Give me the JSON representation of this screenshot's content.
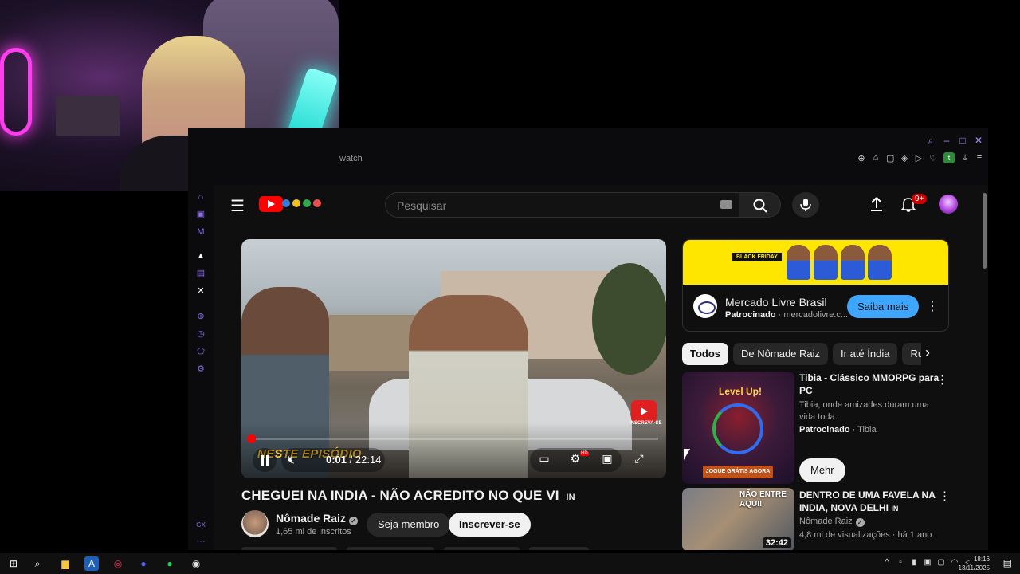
{
  "browser": {
    "url_fragment": "watch"
  },
  "youtube": {
    "search_placeholder": "Pesquisar",
    "notifications_badge": "9+",
    "video": {
      "title": "CHEGUEI NA INDIA - NÃO ACREDITO NO QUE VI",
      "title_suffix": "IN",
      "overlay_text": "NESTE EPISÓDIO",
      "subscribe_watermark": "INSCREVA-SE",
      "current_time": "0:01",
      "duration": "22:14",
      "time_separator": " / ",
      "quality_badge": "HD",
      "progress_fraction": 0.001
    },
    "channel": {
      "name": "Nômade Raiz",
      "subscribers": "1,65 mi de inscritos",
      "member_button": "Seja membro",
      "subscribe_button": "Inscrever-se"
    },
    "ad": {
      "banner_text": "BLACK FRIDAY",
      "advertiser": "Mercado Livre Brasil",
      "sponsored_label": "Patrocinado",
      "domain": "mercadolivre.c...",
      "cta": "Saiba mais"
    },
    "chips": [
      "Todos",
      "De Nômade Raiz",
      "Ir até Índia",
      "Ruas"
    ],
    "sidebar": [
      {
        "title": "Tibia - Clássico MMORPG para PC",
        "description": "Tibia, onde amizades duram uma vida toda.",
        "sponsored_label": "Patrocinado",
        "advertiser": "Tibia",
        "button": "Mehr",
        "thumb_level_text": "Level Up!",
        "thumb_cta": "JOGUE GRÁTIS AGORA"
      },
      {
        "title": "DENTRO DE UMA FAVELA NA INDIA, NOVA DELHI",
        "title_suffix": "IN",
        "channel": "Nômade Raiz",
        "meta": "4,8 mi de visualizações",
        "age": "há 1 ano",
        "duration": "32:42",
        "thumb_text": "NÃO ENTRE AQUI!"
      }
    ]
  },
  "taskbar": {
    "time": "18:16",
    "date": "13/11/2025"
  },
  "colors": {
    "youtube_bg": "#0f0f0f",
    "accent_red": "#ff0000",
    "cta_blue": "#3ea6ff",
    "ad_yellow": "#ffe600",
    "sidebar_purple": "#8b6fe8"
  }
}
